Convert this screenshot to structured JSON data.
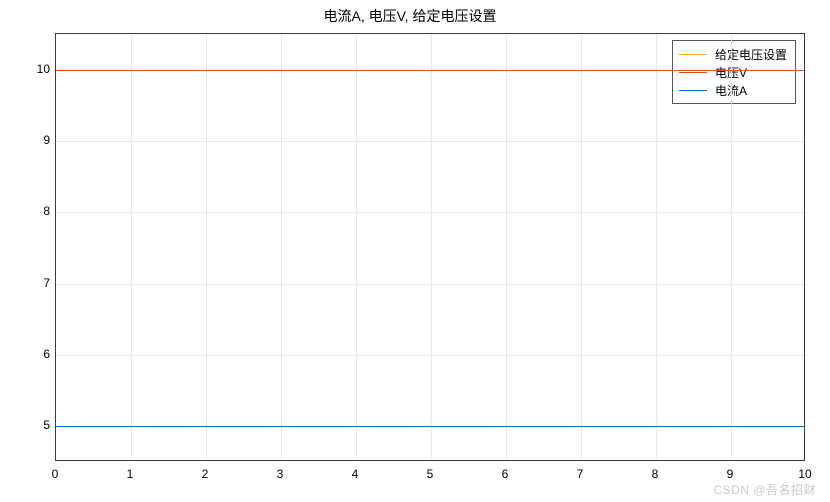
{
  "chart_data": {
    "type": "line",
    "title": "电流A, 电压V, 给定电压设置",
    "xlabel": "",
    "ylabel": "",
    "xlim": [
      0,
      10
    ],
    "ylim": [
      4.5,
      10.5
    ],
    "xticks": [
      0,
      1,
      2,
      3,
      4,
      5,
      6,
      7,
      8,
      9,
      10
    ],
    "yticks": [
      5,
      6,
      7,
      8,
      9,
      10
    ],
    "x": [
      0,
      10
    ],
    "series": [
      {
        "name": "给定电压设置",
        "values": [
          10,
          10
        ],
        "color": "#edb120"
      },
      {
        "name": "电压V",
        "values": [
          10,
          10
        ],
        "color": "#d9541a"
      },
      {
        "name": "电流A",
        "values": [
          5,
          5
        ],
        "color": "#0072bd"
      }
    ],
    "legend_position": "top-right",
    "grid": true
  },
  "watermark": "CSDN @吾名招财"
}
